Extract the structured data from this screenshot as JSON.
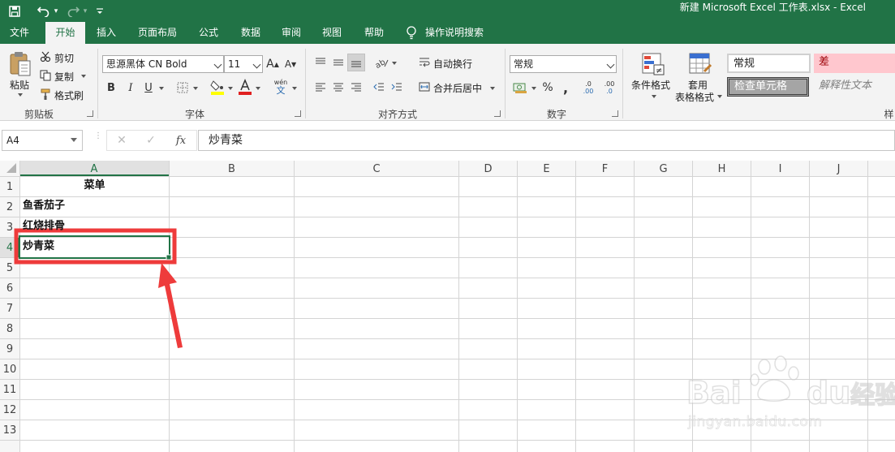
{
  "app": {
    "window_title": "新建 Microsoft Excel 工作表.xlsx  -  Excel",
    "accent": "#217346"
  },
  "quick_access": {
    "icons": [
      "save-icon",
      "undo-icon",
      "redo-icon",
      "customize-icon"
    ]
  },
  "tabs": [
    {
      "label": "文件",
      "active": false
    },
    {
      "label": "开始",
      "active": true
    },
    {
      "label": "插入",
      "active": false
    },
    {
      "label": "页面布局",
      "active": false
    },
    {
      "label": "公式",
      "active": false
    },
    {
      "label": "数据",
      "active": false
    },
    {
      "label": "审阅",
      "active": false
    },
    {
      "label": "视图",
      "active": false
    },
    {
      "label": "帮助",
      "active": false
    }
  ],
  "tell_me": "操作说明搜索",
  "ribbon": {
    "clipboard": {
      "group_label": "剪贴板",
      "paste": "粘贴",
      "cut": "剪切",
      "copy": "复制",
      "format_painter": "格式刷"
    },
    "font": {
      "group_label": "字体",
      "font_name": "思源黑体 CN Bold",
      "font_size": "11",
      "bold": "B",
      "italic": "I",
      "underline": "U",
      "grow": "A",
      "shrink": "A",
      "phonetic_top": "wén",
      "phonetic_bottom": "文"
    },
    "alignment": {
      "group_label": "对齐方式",
      "wrap_text": "自动换行",
      "merge_center": "合并后居中"
    },
    "number": {
      "group_label": "数字",
      "format": "常规",
      "percent": "%",
      "comma": ",",
      "inc_decimal": ".00",
      "dec_decimal": ".0"
    },
    "styles": {
      "group_label": "样",
      "conditional_format": "条件格式",
      "format_table_1": "套用",
      "format_table_2": "表格格式",
      "style_normal": "常规",
      "style_bad": "差",
      "style_check_cell": "检查单元格",
      "style_explanatory": "解释性文本"
    }
  },
  "formula_bar": {
    "name_box": "A4",
    "cancel": "✕",
    "enter": "✓",
    "fx": "fx",
    "content": "炒青菜"
  },
  "sheet": {
    "columns": [
      "A",
      "B",
      "C",
      "D",
      "E",
      "F",
      "G",
      "H",
      "I",
      "J"
    ],
    "rows": [
      "1",
      "2",
      "3",
      "4",
      "5",
      "6",
      "7",
      "8",
      "9",
      "10",
      "11",
      "12",
      "13"
    ],
    "selected_cell": "A4",
    "cells": {
      "A1": "菜单",
      "A2": "鱼香茄子",
      "A3": "红烧排骨",
      "A4": "炒青菜"
    },
    "highlight_color": "#ee3b3b"
  },
  "watermark": {
    "brand": "Bai",
    "brand_suffix": "du",
    "cn": "经验",
    "url": "jingyan.baidu.com"
  }
}
